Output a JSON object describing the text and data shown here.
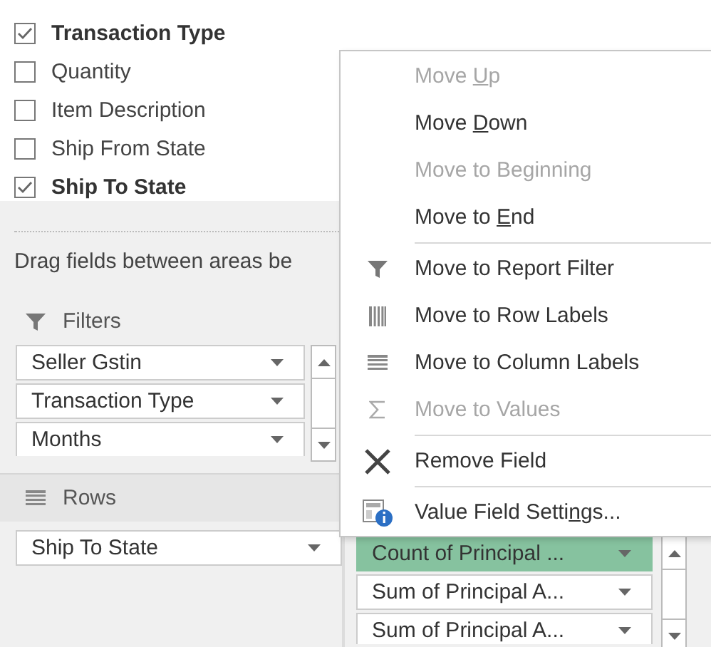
{
  "field_list": [
    {
      "label": "Transaction Type",
      "checked": true
    },
    {
      "label": "Quantity",
      "checked": false
    },
    {
      "label": "Item Description",
      "checked": false
    },
    {
      "label": "Ship From State",
      "checked": false
    },
    {
      "label": "Ship To State",
      "checked": true
    }
  ],
  "hint": "Drag fields between areas be",
  "filters": {
    "title": "Filters",
    "items": [
      "Seller Gstin",
      "Transaction Type",
      "Months"
    ]
  },
  "rows": {
    "title": "Rows",
    "items": [
      "Ship To State"
    ]
  },
  "values": {
    "items": [
      {
        "label": "Count of Principal ...",
        "selected": true
      },
      {
        "label": "Sum of Principal A...",
        "selected": false
      },
      {
        "label": "Sum of Principal A...",
        "selected": false
      }
    ]
  },
  "context_menu": {
    "items": [
      {
        "kind": "plain",
        "label": [
          "Move ",
          "U",
          "p"
        ],
        "disabled": true
      },
      {
        "kind": "plain",
        "label": [
          "Move ",
          "D",
          "own"
        ],
        "disabled": false
      },
      {
        "kind": "plain",
        "label": [
          "Move to Be",
          "g",
          "inning"
        ],
        "disabled": true
      },
      {
        "kind": "plain",
        "label": [
          "Move to ",
          "E",
          "nd"
        ],
        "disabled": false
      },
      {
        "kind": "separator"
      },
      {
        "kind": "filter",
        "label": [
          "Move to Report Filter"
        ],
        "disabled": false
      },
      {
        "kind": "rows",
        "label": [
          "Move to Row Labels"
        ],
        "disabled": false
      },
      {
        "kind": "columns",
        "label": [
          "Move to Column Labels"
        ],
        "disabled": false
      },
      {
        "kind": "values",
        "label": [
          "Move to Values"
        ],
        "disabled": true
      },
      {
        "kind": "separator"
      },
      {
        "kind": "remove",
        "label": [
          "Remove Field"
        ],
        "disabled": false
      },
      {
        "kind": "separator"
      },
      {
        "kind": "settings",
        "label": [
          "Value Field Setti",
          "n",
          "gs..."
        ],
        "disabled": false
      }
    ]
  }
}
